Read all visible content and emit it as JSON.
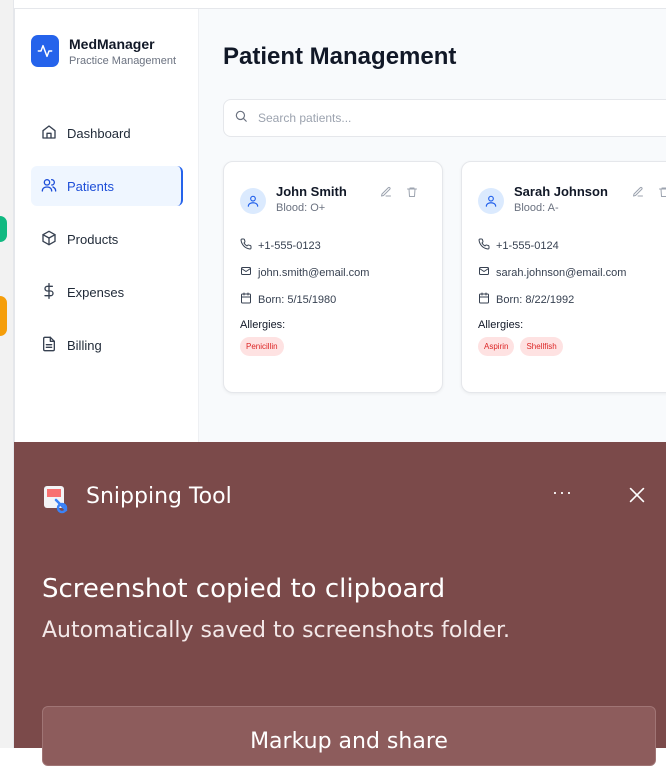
{
  "brand": {
    "title": "MedManager",
    "subtitle": "Practice Management",
    "color": "#2563eb"
  },
  "sidebar": {
    "items": [
      {
        "label": "Dashboard",
        "icon": "home-icon",
        "active": false
      },
      {
        "label": "Patients",
        "icon": "users-icon",
        "active": true
      },
      {
        "label": "Products",
        "icon": "package-icon",
        "active": false
      },
      {
        "label": "Expenses",
        "icon": "dollar-icon",
        "active": false
      },
      {
        "label": "Billing",
        "icon": "file-icon",
        "active": false
      }
    ]
  },
  "main": {
    "title": "Patient Management",
    "search": {
      "placeholder": "Search patients...",
      "value": ""
    }
  },
  "patients": [
    {
      "name": "John Smith",
      "blood": "Blood: O+",
      "phone": "+1-555-0123",
      "email": "john.smith@email.com",
      "born": "Born: 5/15/1980",
      "allergies_label": "Allergies:",
      "allergies": [
        "Penicillin"
      ]
    },
    {
      "name": "Sarah Johnson",
      "blood": "Blood: A-",
      "phone": "+1-555-0124",
      "email": "sarah.johnson@email.com",
      "born": "Born: 8/22/1992",
      "allergies_label": "Allergies:",
      "allergies": [
        "Aspirin",
        "Shellfish"
      ]
    }
  ],
  "toast": {
    "app_name": "Snipping Tool",
    "more": "···",
    "title": "Screenshot copied to clipboard",
    "body": "Automatically saved to screenshots folder.",
    "button": "Markup and share",
    "background": "#7b4a4a"
  }
}
